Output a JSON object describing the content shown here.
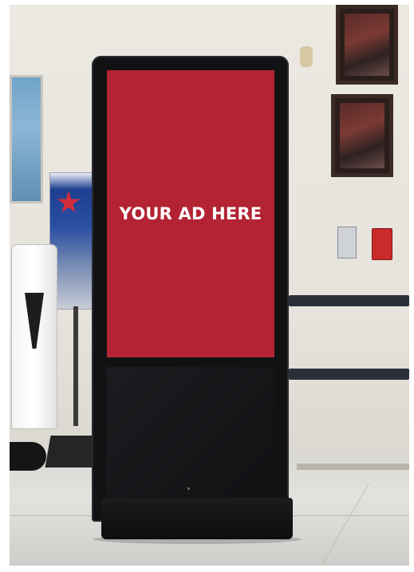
{
  "screen": {
    "ad_text": "YOUR AD HERE",
    "background_color": "#b32333",
    "text_color": "#ffffff"
  },
  "scene": {
    "kiosk_color": "#111214",
    "wall_color": "#ece9e3",
    "icons": [
      "framed-picture",
      "framed-picture",
      "banner-stand",
      "umbrella-bag-dispenser",
      "light-switch",
      "fire-alarm",
      "wall-light"
    ]
  }
}
